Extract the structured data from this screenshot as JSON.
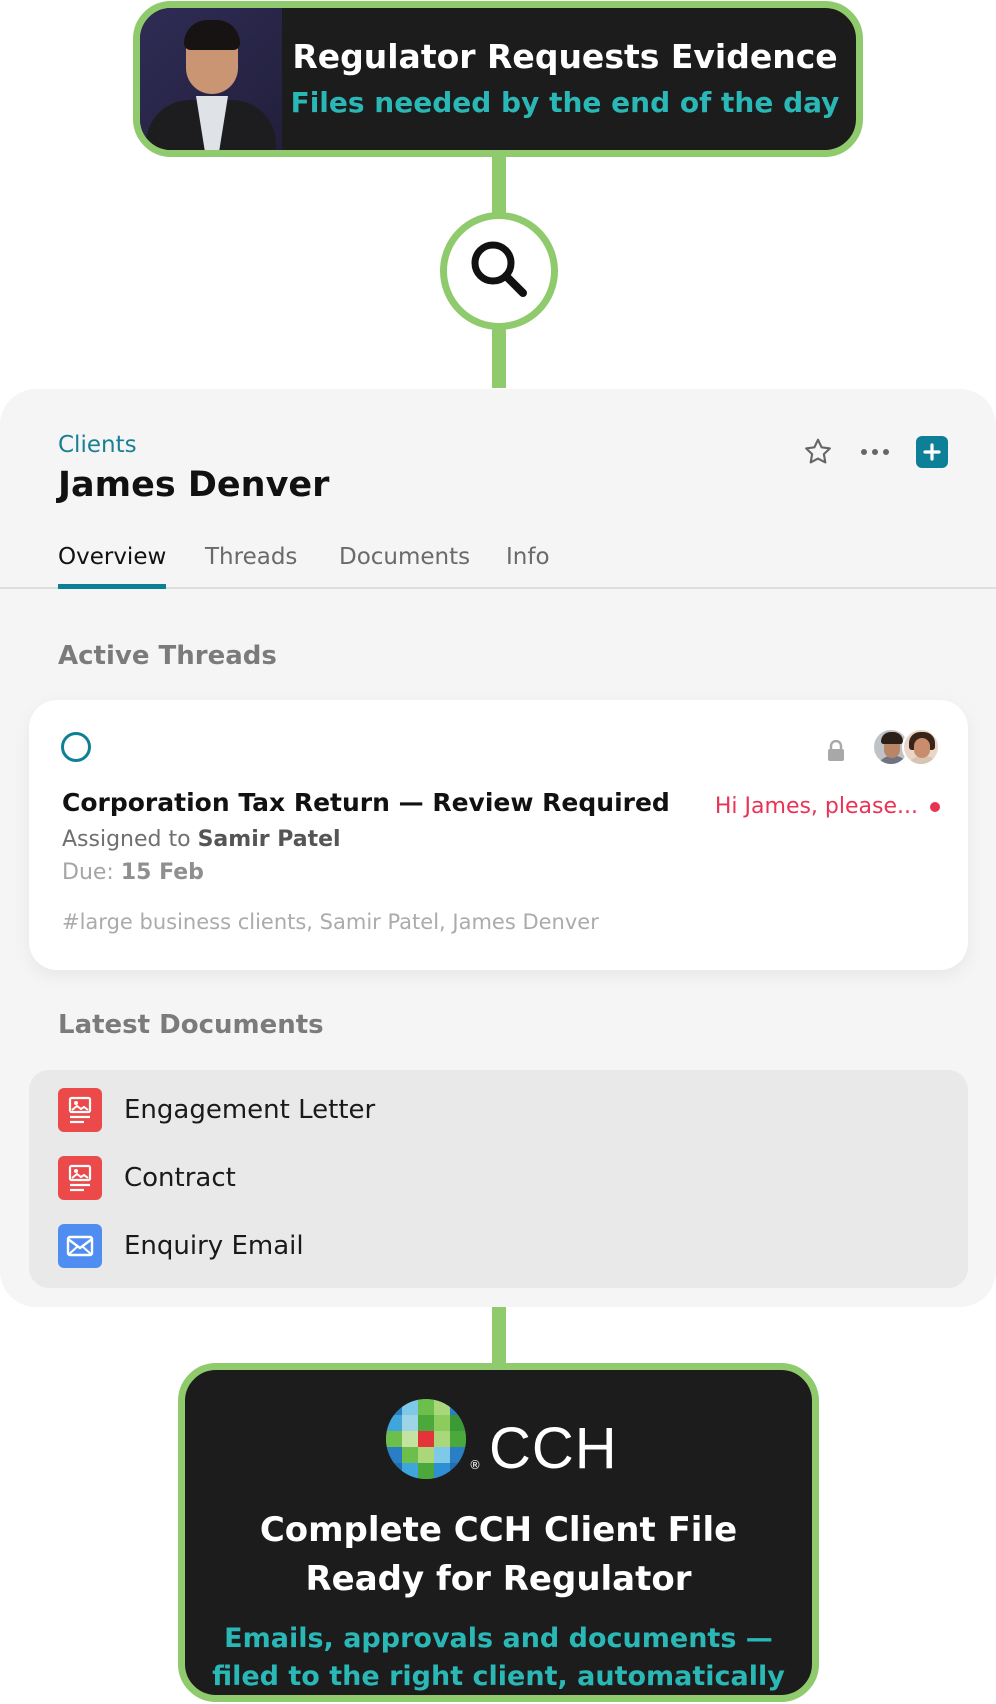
{
  "top_card": {
    "title": "Regulator Requests Evidence",
    "subtitle": "Files needed by the end of the day"
  },
  "client": {
    "breadcrumb": "Clients",
    "name": "James Denver"
  },
  "tabs": [
    {
      "label": "Overview",
      "active": true
    },
    {
      "label": "Threads",
      "active": false
    },
    {
      "label": "Documents",
      "active": false
    },
    {
      "label": "Info",
      "active": false
    }
  ],
  "active_threads": {
    "heading": "Active Threads",
    "thread": {
      "title": "Corporation Tax Return — Review Required",
      "assigned_prefix": "Assigned to",
      "assignee": "Samir Patel",
      "due_prefix": "Due:",
      "due_date": "15 Feb",
      "tags": "#large business clients, Samir Patel, James Denver",
      "preview": "Hi James, please..."
    }
  },
  "latest_documents": {
    "heading": "Latest Documents",
    "items": [
      {
        "label": "Engagement Letter",
        "icon": "image-document-icon"
      },
      {
        "label": "Contract",
        "icon": "image-document-icon"
      },
      {
        "label": "Enquiry Email",
        "icon": "email-icon"
      }
    ]
  },
  "bottom_card": {
    "brand": "CCH",
    "brand_mark": "®",
    "title_line1": "Complete CCH Client File",
    "title_line2": "Ready for Regulator",
    "subtitle_line1": "Emails, approvals and documents —",
    "subtitle_line2": "filed to the right client, automatically"
  },
  "colors": {
    "accent_green": "#8fca6c",
    "accent_teal": "#2ab8b7",
    "brand_blue": "#0d8097",
    "alert_red": "#ea3354"
  }
}
